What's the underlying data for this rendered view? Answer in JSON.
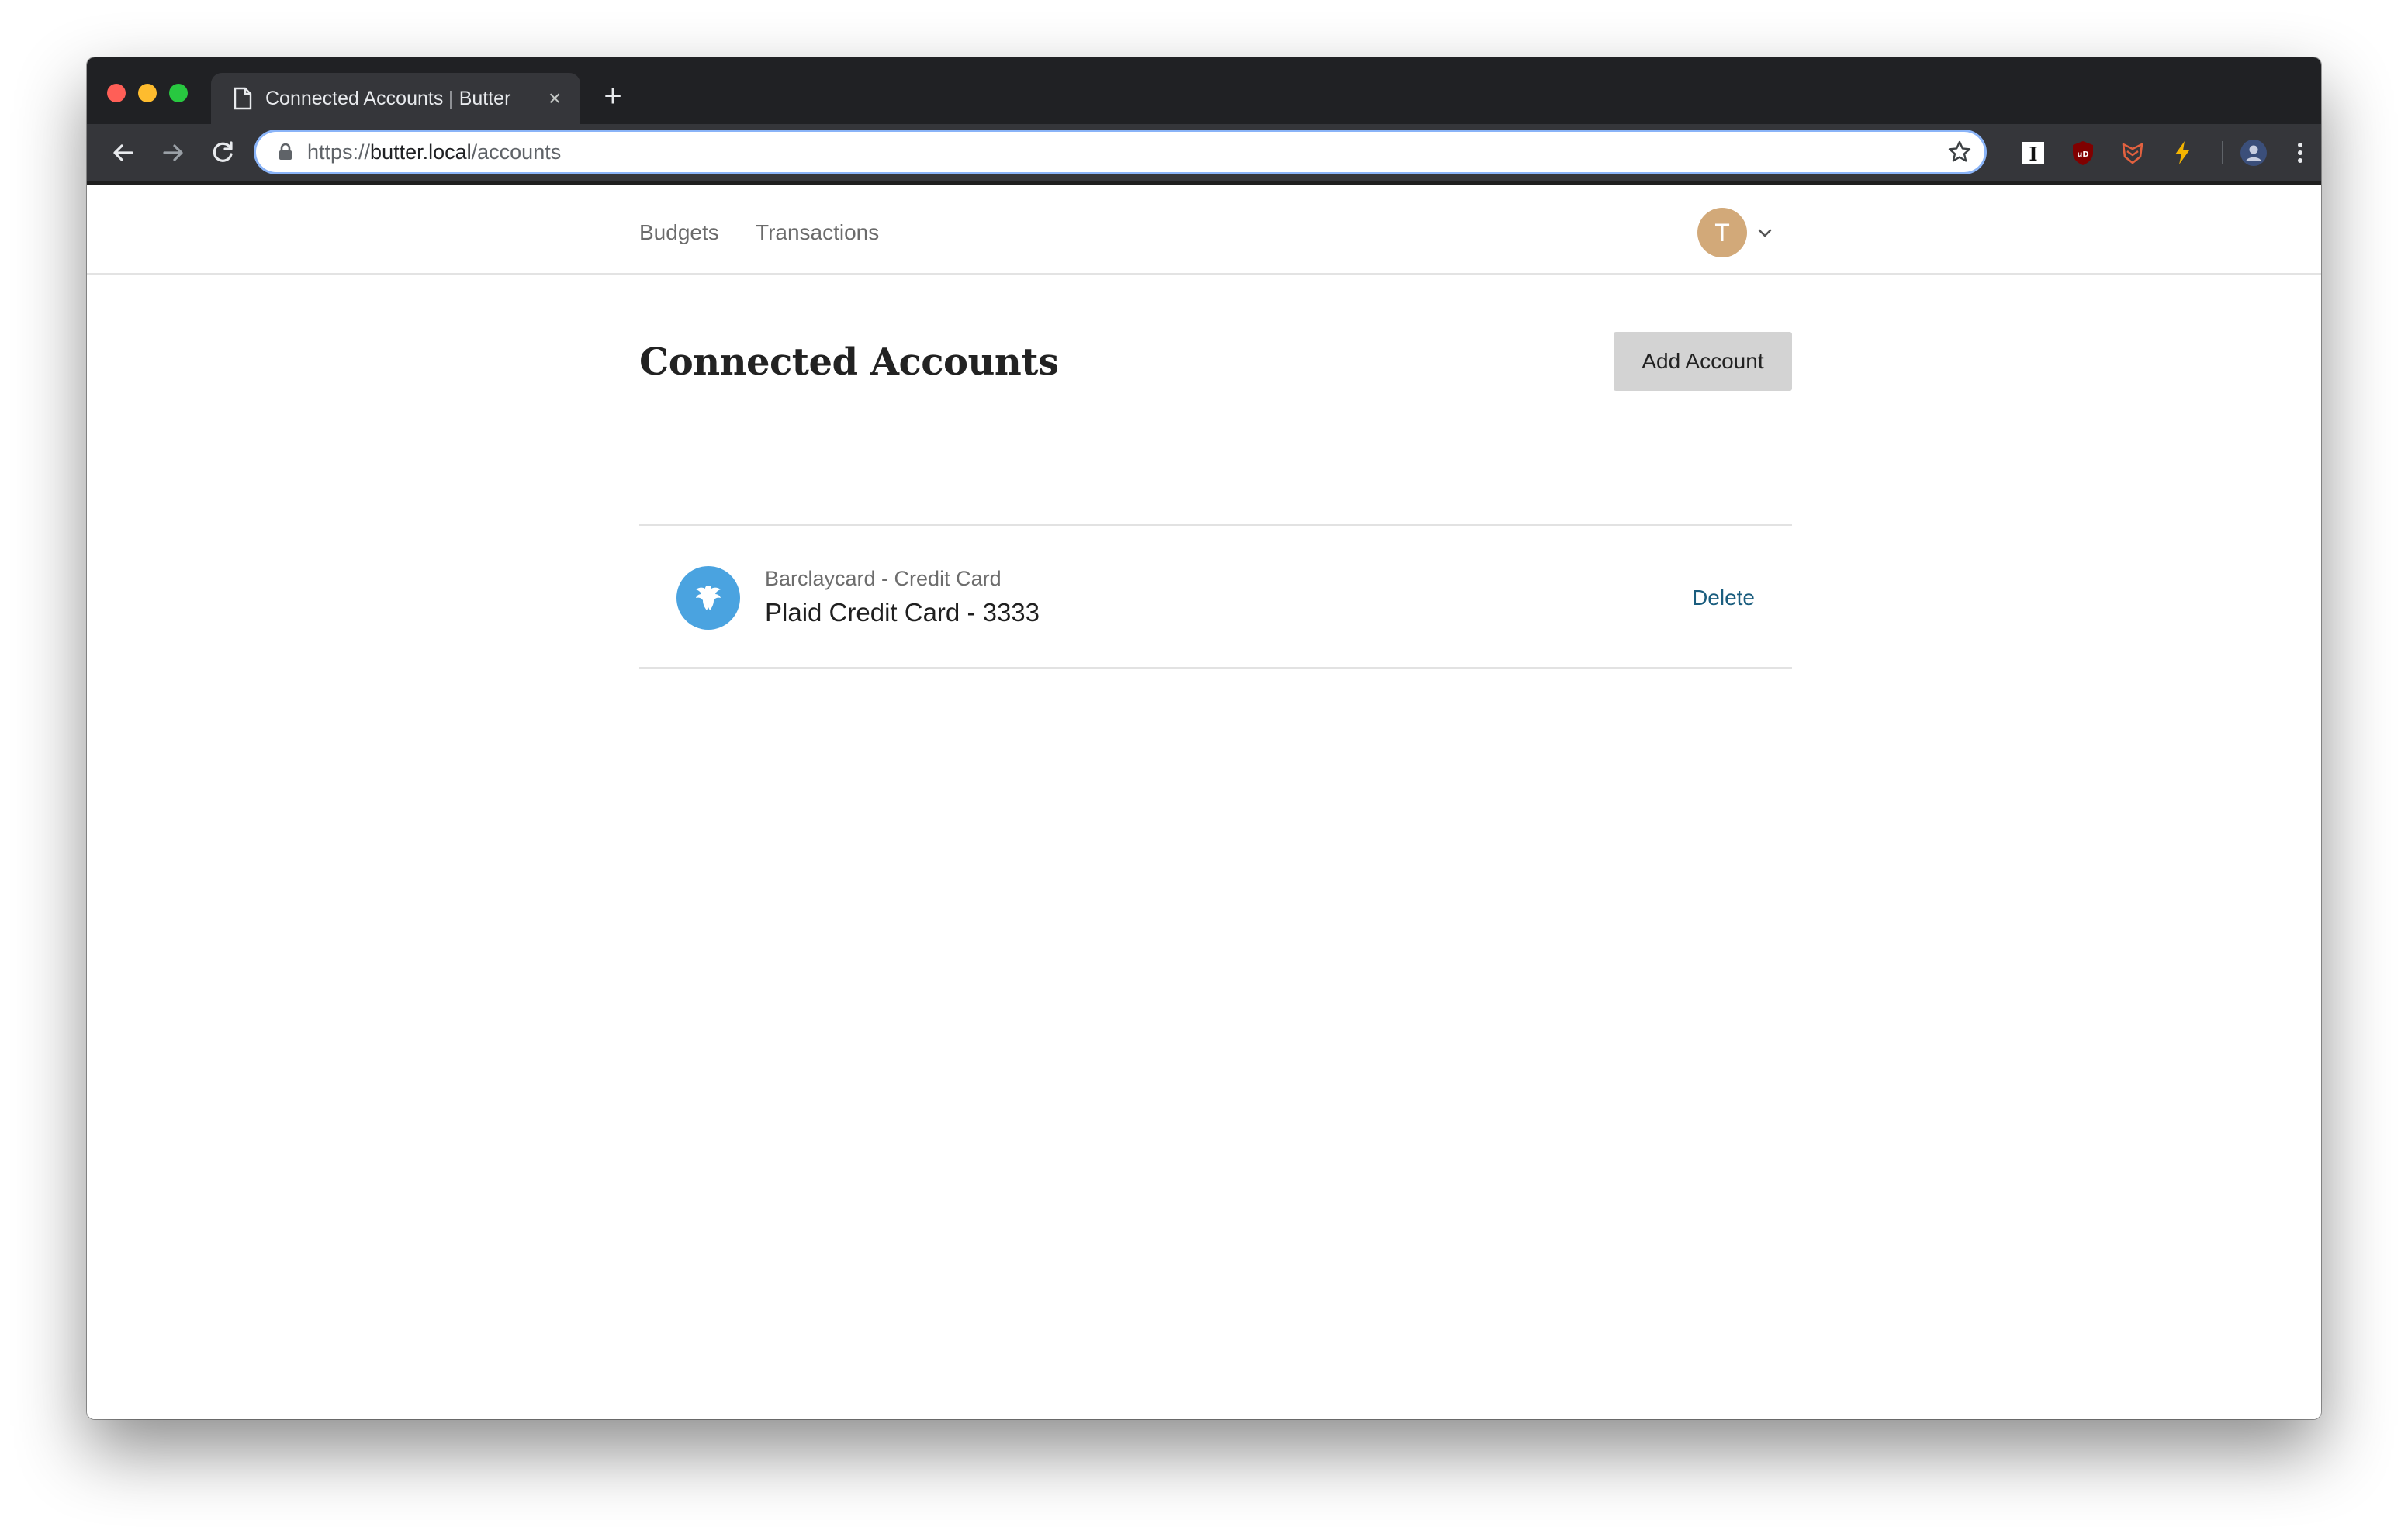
{
  "browser": {
    "tab": {
      "title": "Connected Accounts | Butter",
      "close": "×"
    },
    "new_tab": "+",
    "url": {
      "scheme": "https://",
      "host": "butter.local",
      "path": "/accounts"
    },
    "extension_instapaper_label": "I",
    "extension_ublock_label": "uD"
  },
  "header": {
    "nav": [
      {
        "label": "Budgets"
      },
      {
        "label": "Transactions"
      }
    ],
    "avatar_initial": "T"
  },
  "main": {
    "title": "Connected Accounts",
    "add_button_label": "Add Account",
    "accounts": [
      {
        "institution": "Barclaycard - Credit Card",
        "name": "Plaid Credit Card - 3333",
        "delete_label": "Delete",
        "logo_color": "#4aa3e0"
      }
    ]
  },
  "colors": {
    "link": "#1a5d7e",
    "avatar": "#d2a979",
    "button_bg": "#d3d3d3"
  }
}
